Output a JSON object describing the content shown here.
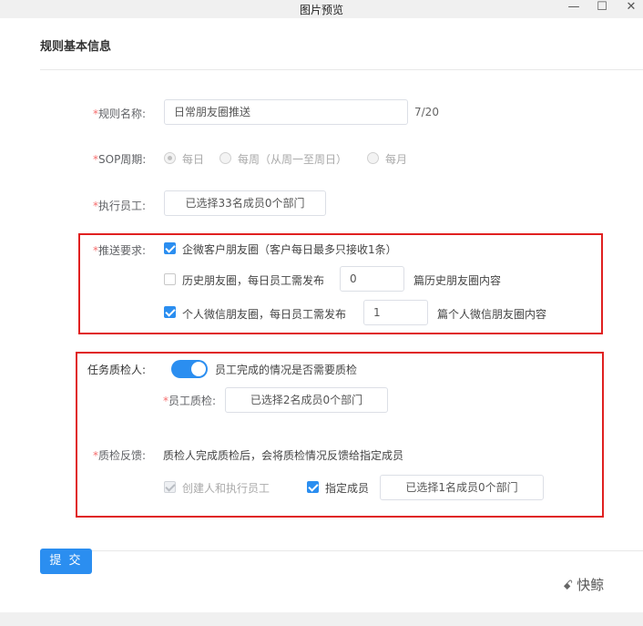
{
  "window": {
    "title": "图片预览",
    "minimize": "—",
    "maximize": "☐",
    "close": "✕"
  },
  "section_title": "规则基本信息",
  "rule_name": {
    "required_mark": "*",
    "label": "规则名称:",
    "value": "日常朋友圈推送",
    "count": "7/20"
  },
  "sop_cycle": {
    "required_mark": "*",
    "label": "SOP周期:",
    "options": [
      "每日",
      "每周（从周一至周日）",
      "每月"
    ],
    "selected": 0
  },
  "executor": {
    "required_mark": "*",
    "label": "执行员工:",
    "value": "已选择33名成员0个部门"
  },
  "push": {
    "required_mark": "*",
    "label": "推送要求:",
    "opt1": {
      "text": "企微客户朋友圈（客户每日最多只接收1条）",
      "checked": true
    },
    "opt2": {
      "prefix": "历史朋友圈，每日员工需发布",
      "value": "0",
      "suffix": "篇历史朋友圈内容",
      "checked": false
    },
    "opt3": {
      "prefix": "个人微信朋友圈，每日员工需发布",
      "value": "1",
      "suffix": "篇个人微信朋友圈内容",
      "checked": true
    }
  },
  "qc": {
    "label": "任务质检人:",
    "toggle_on": true,
    "toggle_text": "员工完成的情况是否需要质检",
    "inspector": {
      "required_mark": "*",
      "label": "员工质检:",
      "value": "已选择2名成员0个部门"
    },
    "feedback": {
      "required_mark": "*",
      "label": "质检反馈:",
      "desc": "质检人完成质检后，会将质检情况反馈给指定成员",
      "creator_label": "创建人和执行员工",
      "member_label": "指定成员",
      "member_value": "已选择1名成员0个部门"
    }
  },
  "submit_label": "提 交",
  "watermark": {
    "icon": "speech-bubbles-icon",
    "text": "快鲸"
  },
  "colors": {
    "accent": "#2b8ef0",
    "highlight_box": "#e02020",
    "required": "#f56c6c"
  }
}
